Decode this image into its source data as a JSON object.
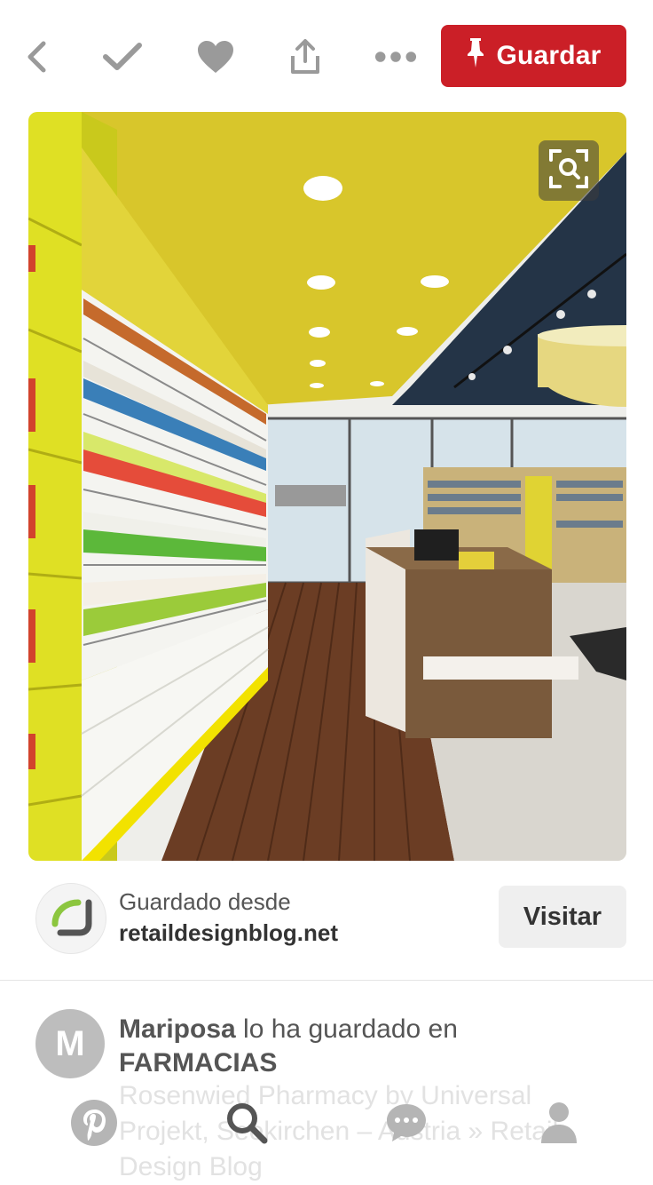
{
  "toolbar": {
    "save_label": "Guardar",
    "icons": [
      "back-icon",
      "check-icon",
      "heart-icon",
      "share-icon",
      "more-icon",
      "pin-icon"
    ],
    "accent_color": "#cb1f27"
  },
  "pin": {
    "visual_search_icon": "visual-search-icon"
  },
  "source": {
    "label": "Guardado desde",
    "domain": "retaildesignblog.net",
    "visit_label": "Visitar"
  },
  "saver": {
    "avatar_letter": "M",
    "name": "Mariposa",
    "action": " lo ha guardado en",
    "board": "FARMACIAS",
    "description": "Rosenwied Pharmacy by Universal Projekt, Seekirchen – Austria » Retail Design Blog"
  },
  "bottom_nav": {
    "items": [
      "pinterest-home-icon",
      "search-icon",
      "messages-icon",
      "profile-icon"
    ]
  }
}
